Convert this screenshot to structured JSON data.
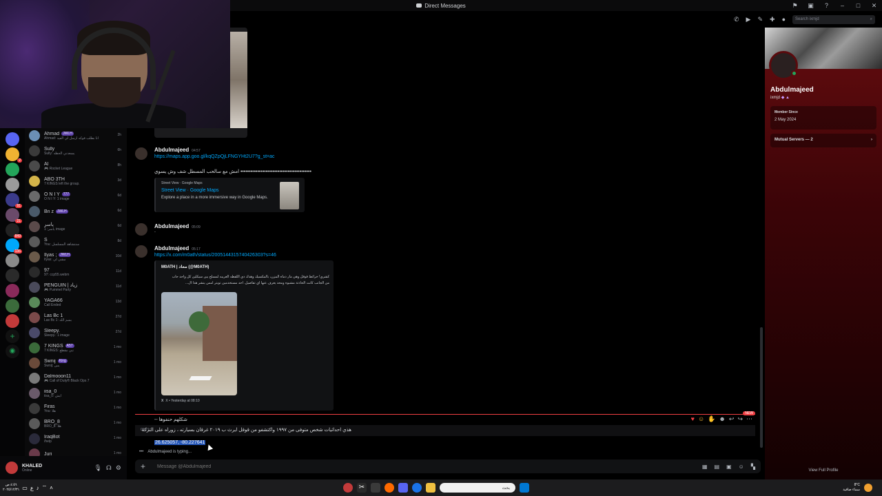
{
  "window": {
    "title": "Direct Messages"
  },
  "header": {
    "search_placeholder": "Search ixmjd"
  },
  "dm_list": [
    {
      "name": "Ahmad",
      "tag": "JWLH",
      "sub": "Ahmad: انا بطلب فوكه ارسل لي الفيد",
      "time": "2h",
      "color": "#6b8fb5"
    },
    {
      "name": "Sully",
      "tag": "",
      "sub": "Sully: يسعدني الحظه",
      "time": "6h",
      "color": "#3a3a3a"
    },
    {
      "name": "Al",
      "tag": "",
      "sub": "🎮 Rocket League",
      "time": "8h",
      "color": "#4a4a4a"
    },
    {
      "name": "ABO 3TH",
      "tag": "",
      "sub": "7 KINGS left the group.",
      "time": "3d",
      "color": "#d4b44a"
    },
    {
      "name": "O N I Y",
      "tag": "777",
      "sub": "O N I Y: 1 image",
      "time": "6d",
      "color": "#6a6a6a"
    },
    {
      "name": "Bn z",
      "tag": "JWLH",
      "sub": "",
      "time": "6d",
      "color": "#4a5a6a"
    },
    {
      "name": "ياسر",
      "tag": "",
      "sub": "ياسر: 1 image",
      "time": "6d",
      "color": "#5a4a4a"
    },
    {
      "name": "S",
      "tag": "",
      "sub": "You: سنتشاهد المسلسل",
      "time": "8d",
      "color": "#5a5a5a"
    },
    {
      "name": "Ilyas ;",
      "tag": "JWLH",
      "sub": "Ilyas: مشي لي",
      "time": "10d",
      "color": "#6a5a4a"
    },
    {
      "name": "97",
      "tag": "",
      "sub": "97: ccp55.webm",
      "time": "11d",
      "color": "#2a2a2a"
    },
    {
      "name": "PENGUIN | زياد",
      "tag": "",
      "sub": "🎮 Pummel Party",
      "time": "11d",
      "color": "#4a4a5a"
    },
    {
      "name": "YAGA66",
      "tag": "",
      "sub": "Call Ended",
      "time": "13d",
      "color": "#5a8a5a"
    },
    {
      "name": "Las Bc 1",
      "tag": "",
      "sub": "Las Bc 1: بسم الله",
      "time": "27d",
      "color": "#7a4a4a"
    },
    {
      "name": "Sleepy.",
      "tag": "",
      "sub": "Sleepy.: 1 image",
      "time": "27d",
      "color": "#4a4a6a"
    },
    {
      "name": "7 KINGS",
      "tag": "A57",
      "sub": "7 KINGS: تبي مقطع",
      "time": "1 mo",
      "color": "#3a6a3a"
    },
    {
      "name": "Swnij",
      "tag": "King",
      "sub": "Swnij: يس",
      "time": "1 mo",
      "color": "#6a4a3a"
    },
    {
      "name": "Dalmooon11",
      "tag": "",
      "sub": "🎮 Call of Duty® Black Ops 7",
      "time": "1 mo",
      "color": "#7a7a7a"
    },
    {
      "name": "iisa_0",
      "tag": "",
      "sub": "iisa_0: ايش",
      "time": "1 mo",
      "color": "#6a5a6a"
    },
    {
      "name": "Firas",
      "tag": "",
      "sub": "You: هلا",
      "time": "1 mo",
      "color": "#3a3a3a"
    },
    {
      "name": "BRO_8",
      "tag": "",
      "sub": "BRO_8: هلا",
      "time": "1 mo",
      "color": "#5a5a5a"
    },
    {
      "name": "IraqBot",
      "tag": "",
      "sub": "/help",
      "time": "1 mo",
      "color": "#2a2a3a"
    },
    {
      "name": "Juri",
      "tag": "",
      "sub": "",
      "time": "1 mo",
      "color": "#6a3a4a"
    }
  ],
  "user": {
    "name": "KHALED",
    "status": "Online"
  },
  "messages": {
    "m1": {
      "author": "Abdulmajeed",
      "time": "04:57",
      "link": "https://maps.app.goo.gl/kqQZpQjLFNGYHt2U7?g_st=ac",
      "text": "•••••••••••••••••••••••••••••••••••••••••• امش مع سالحب المسطل شف وش يسوي",
      "embed": {
        "provider": "Street View · Google Maps",
        "title": "Street View · Google Maps",
        "desc": "Explore a place in a more immersive way in Google Maps."
      }
    },
    "m2": {
      "author": "Abdulmajeed",
      "time": "05:09",
      "text": "."
    },
    "m3": {
      "author": "Abdulmajeed",
      "time": "05:17",
      "link": "https://x.com/m0ath/status/2005144315740426303?s=46",
      "embed": {
        "provider": "M0ATH | معاذ (@M0ATH)",
        "desc1": "كشري! خرائط قوقل وهي مار دماه المزن، بالمكسيك وهذك دي اللقطه الغريبه لمسلح يبن سيكلين كل واحد حاب",
        "desc2": "من الجانب كانت الحادثة مشبوه ومحد يعرف عنها اي تفاصيل. احد مستخدمين تويتر امس ينشر هذا ال...",
        "footer": "X • Yesterday at 08:10"
      }
    },
    "m4": {
      "text1": "شكلهم حنفوها --",
      "time": "05:21",
      "text2": "هذي احداثيات شخص متوفى من ١٩٩٧ واكتشفو من قوقل ايرث ب ٢٠١٩ غرقان بسيارته ، زوراه على التركه",
      "selected": "26.625057, -80.227641"
    },
    "typing": "Abdulmajeed is typing...",
    "new_label": "NEW"
  },
  "composer": {
    "placeholder": "Message @Abdulmajeed"
  },
  "profile": {
    "name": "Abdulmajeed",
    "username": "ixmjd",
    "member_since_label": "Member Since",
    "member_since": "2 May 2024",
    "mutual_servers": "Mutual Servers — 2",
    "view_full": "View Full Profile"
  },
  "taskbar": {
    "time": "٤:٥٦ ص",
    "date": "٢٠٢٥/١٢/٣١",
    "search_placeholder": "بحث",
    "weather_temp": "8°C",
    "weather_desc": "سماء صافية",
    "lang": "ع"
  }
}
